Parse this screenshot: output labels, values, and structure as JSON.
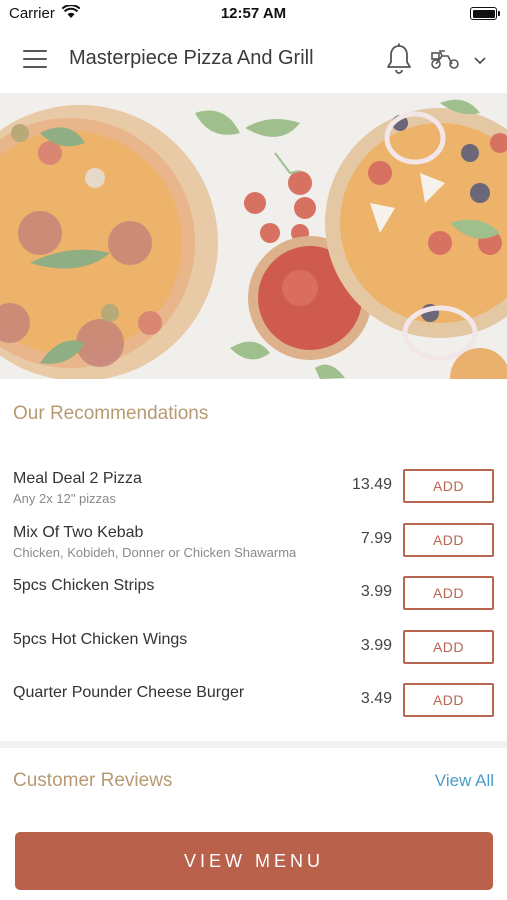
{
  "status_bar": {
    "carrier": "Carrier",
    "time": "12:57 AM"
  },
  "header": {
    "title": "Masterpiece Pizza And Grill",
    "icons": [
      "menu-icon",
      "bell-icon",
      "delivery-scooter-icon",
      "chevron-down-icon"
    ]
  },
  "recommendations": {
    "title": "Our Recommendations",
    "add_label": "ADD",
    "items": [
      {
        "name": "Meal Deal 2 Pizza",
        "description": "Any 2x 12\" pizzas",
        "price": "13.49"
      },
      {
        "name": "Mix Of Two Kebab",
        "description": "Chicken, Kobideh, Donner or Chicken Shawarma",
        "price": "7.99"
      },
      {
        "name": "5pcs Chicken Strips",
        "description": "",
        "price": "3.99"
      },
      {
        "name": "5pcs Hot Chicken Wings",
        "description": "",
        "price": "3.99"
      },
      {
        "name": "Quarter Pounder Cheese Burger",
        "description": "",
        "price": "3.49"
      }
    ]
  },
  "reviews": {
    "title": "Customer Reviews",
    "view_all": "View All"
  },
  "footer": {
    "view_menu": "VIEW MENU"
  },
  "colors": {
    "accent": "#b9614b",
    "section_title": "#b79a72",
    "link": "#4a9ec7"
  }
}
